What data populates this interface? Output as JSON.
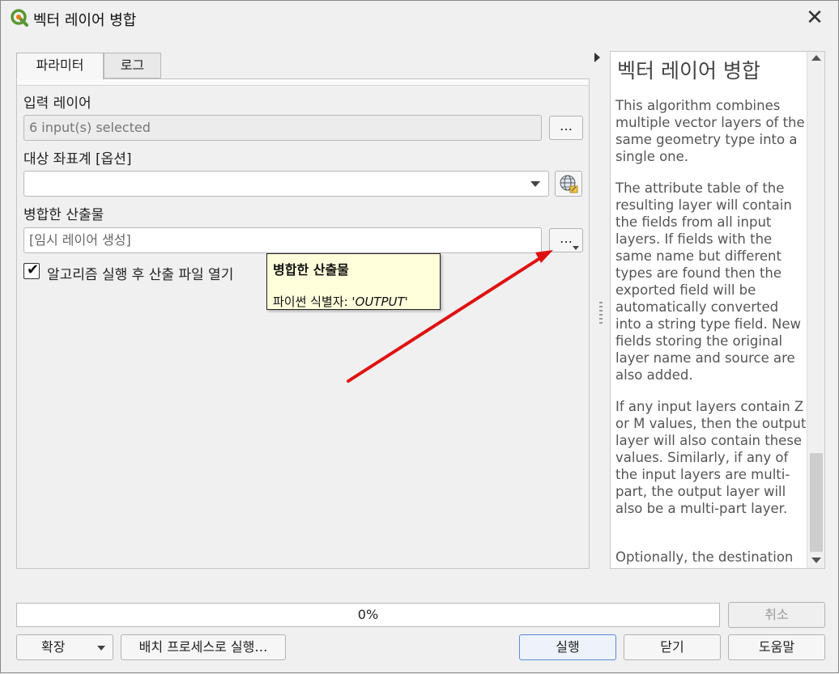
{
  "window": {
    "title": "벡터 레이어 병합",
    "close_glyph": "✕"
  },
  "tabs": [
    {
      "label": "파라미터",
      "active": true
    },
    {
      "label": "로그",
      "active": false
    }
  ],
  "params": {
    "input_layer_label": "입력 레이어",
    "input_layer_value": "6 input(s) selected",
    "ellipsis": "…",
    "target_crs_label": "대상 좌표계 [옵션]",
    "target_crs_value": "",
    "output_label": "병합한 산출물",
    "output_placeholder": "[임시 레이어 생성]",
    "open_after_label": "알고리즘 실행 후 산출 파일 열기",
    "open_after_checked": true
  },
  "tooltip": {
    "title": "병합한 산출물",
    "body_prefix": "파이썬 식별자: ",
    "identifier": "'OUTPUT'"
  },
  "help": {
    "title": "벡터 레이어 병합",
    "paragraphs": [
      "This algorithm combines multiple vector layers of the same geometry type into a single one.",
      "The attribute table of the resulting layer will contain the fields from all input layers. If fields with the same name but different types are found then the exported field will be automatically converted into a string type field. New fields storing the original layer name and source are also added.",
      "If any input layers contain Z or M values, then the output layer will also contain these values. Similarly, if any of the input layers are multi-part, the output layer will also be a multi-part layer.",
      "Optionally, the destination coordinate reference"
    ]
  },
  "progress": {
    "text": "0%",
    "value": 0
  },
  "buttons": {
    "cancel": "취소",
    "advanced": "확장",
    "batch": "배치 프로세스로 실행…",
    "run": "실행",
    "close": "닫기",
    "help": "도움말"
  },
  "colors": {
    "tooltip_bg": "#ffffdc",
    "annotation_arrow": "#e01010",
    "primary_border": "#5a8cd8"
  }
}
